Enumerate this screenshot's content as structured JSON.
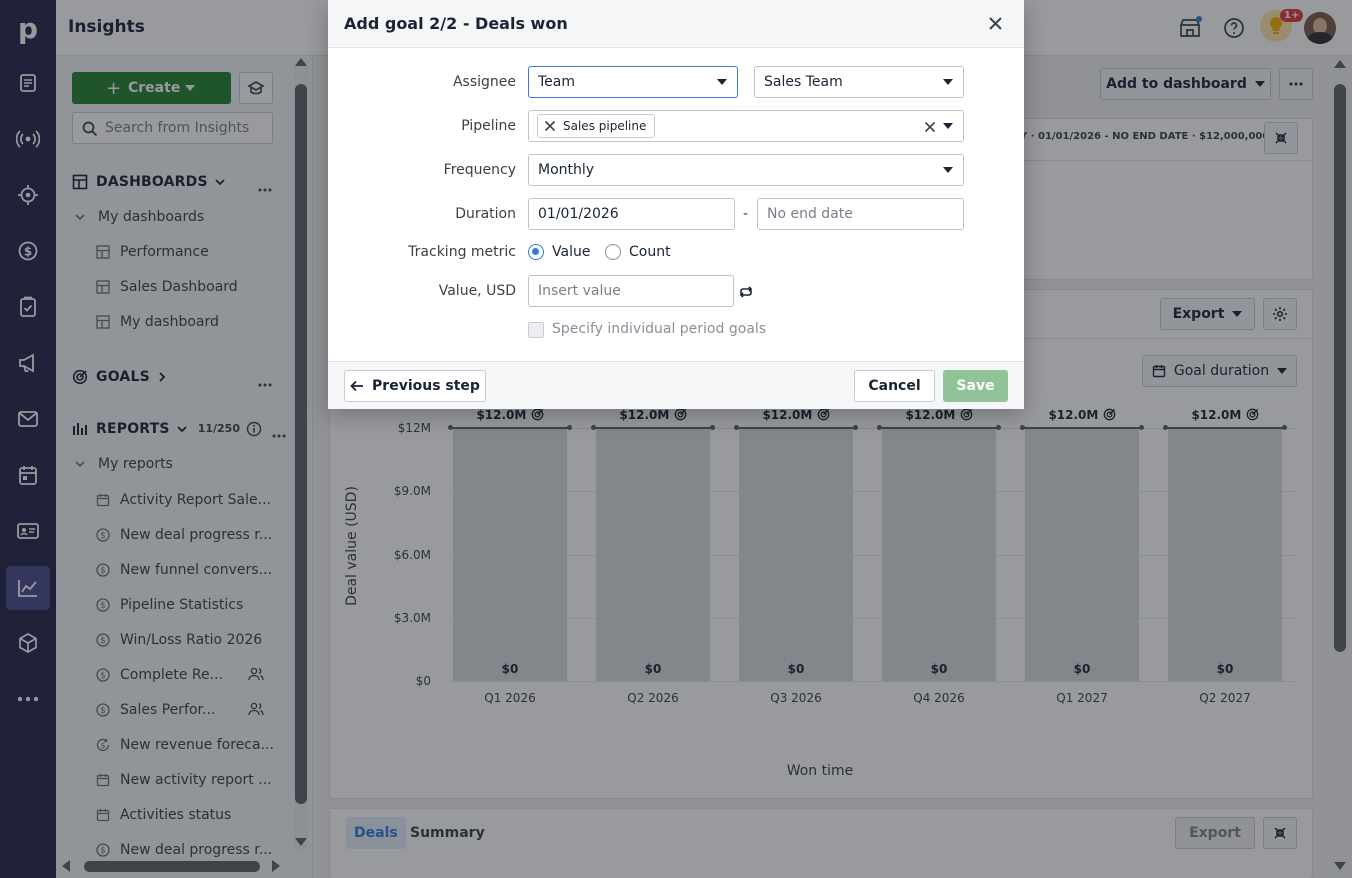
{
  "app": {
    "title": "Insights"
  },
  "rail": {
    "items": [
      "leads-icon",
      "deals-icon",
      "projects-icon",
      "money-icon",
      "tasks-icon",
      "campaigns-icon",
      "mail-icon",
      "calendar-icon",
      "contacts-icon",
      "insights-icon",
      "products-icon",
      "more-icon"
    ]
  },
  "topbar": {
    "notification_badge": "1+"
  },
  "sidebar": {
    "create_label": "Create",
    "search_placeholder": "Search from Insights",
    "dashboards_title": "DASHBOARDS",
    "my_dashboards": "My dashboards",
    "dashboards": [
      "Performance",
      "Sales Dashboard",
      "My dashboard"
    ],
    "goals_title": "GOALS",
    "reports_title": "REPORTS",
    "reports_count": "11/250",
    "my_reports": "My reports",
    "reports": [
      {
        "label": "Activity Report Sale...",
        "icon": "calendar-icon",
        "shared": false
      },
      {
        "label": "New deal progress r...",
        "icon": "dollar-icon",
        "shared": false
      },
      {
        "label": "New funnel convers...",
        "icon": "dollar-icon",
        "shared": false
      },
      {
        "label": "Pipeline Statistics",
        "icon": "dollar-icon",
        "shared": false
      },
      {
        "label": "Win/Loss Ratio 2026",
        "icon": "dollar-icon",
        "shared": false
      },
      {
        "label": "Complete Re...",
        "icon": "dollar-icon",
        "shared": true
      },
      {
        "label": "Sales Perfor...",
        "icon": "dollar-icon",
        "shared": true
      },
      {
        "label": "New revenue foreca...",
        "icon": "revenue-icon",
        "shared": false
      },
      {
        "label": "New activity report ...",
        "icon": "calendar-icon",
        "shared": false
      },
      {
        "label": "Activities status",
        "icon": "calendar-icon",
        "shared": false
      },
      {
        "label": "New deal progress r...",
        "icon": "dollar-icon",
        "shared": false
      }
    ]
  },
  "main": {
    "add_to_dashboard": "Add to dashboard",
    "goal_summary_text": "01/01/2026 - NO END DATE",
    "goal_summary_value": "$12,000,000",
    "export_label": "Export",
    "goal_duration_label": "Goal duration",
    "tabs": [
      "Deals",
      "Summary"
    ],
    "bottom_export": "Export"
  },
  "chart_data": {
    "type": "bar",
    "categories": [
      "Q1 2026",
      "Q2 2026",
      "Q3 2026",
      "Q4 2026",
      "Q1 2027",
      "Q2 2027"
    ],
    "values": [
      0,
      0,
      0,
      0,
      0,
      0
    ],
    "value_labels": [
      "$0",
      "$0",
      "$0",
      "$0",
      "$0",
      "$0"
    ],
    "goal": 12000000,
    "goal_labels": [
      "$12.0M",
      "$12.0M",
      "$12.0M",
      "$12.0M",
      "$12.0M",
      "$12.0M"
    ],
    "yticks": [
      "$0",
      "$3.0M",
      "$6.0M",
      "$9.0M",
      "$12M"
    ],
    "ytick_values": [
      0,
      3000000,
      6000000,
      9000000,
      12000000
    ],
    "ylim": [
      0,
      12000000
    ],
    "ylabel": "Deal value (USD)",
    "xlabel": "Won time",
    "grid": true
  },
  "modal": {
    "title": "Add goal 2/2 - Deals won",
    "assignee_label": "Assignee",
    "assignee_type": "Team",
    "assignee_value": "Sales Team",
    "pipeline_label": "Pipeline",
    "pipeline_chip": "Sales pipeline",
    "frequency_label": "Frequency",
    "frequency_value": "Monthly",
    "duration_label": "Duration",
    "duration_start": "01/01/2026",
    "duration_sep": "-",
    "duration_end_placeholder": "No end date",
    "tracking_label": "Tracking metric",
    "tracking_value": "Value",
    "tracking_count": "Count",
    "value_label": "Value, USD",
    "value_placeholder": "Insert value",
    "specify_label": "Specify individual period goals",
    "previous_label": "Previous step",
    "cancel_label": "Cancel",
    "save_label": "Save"
  }
}
